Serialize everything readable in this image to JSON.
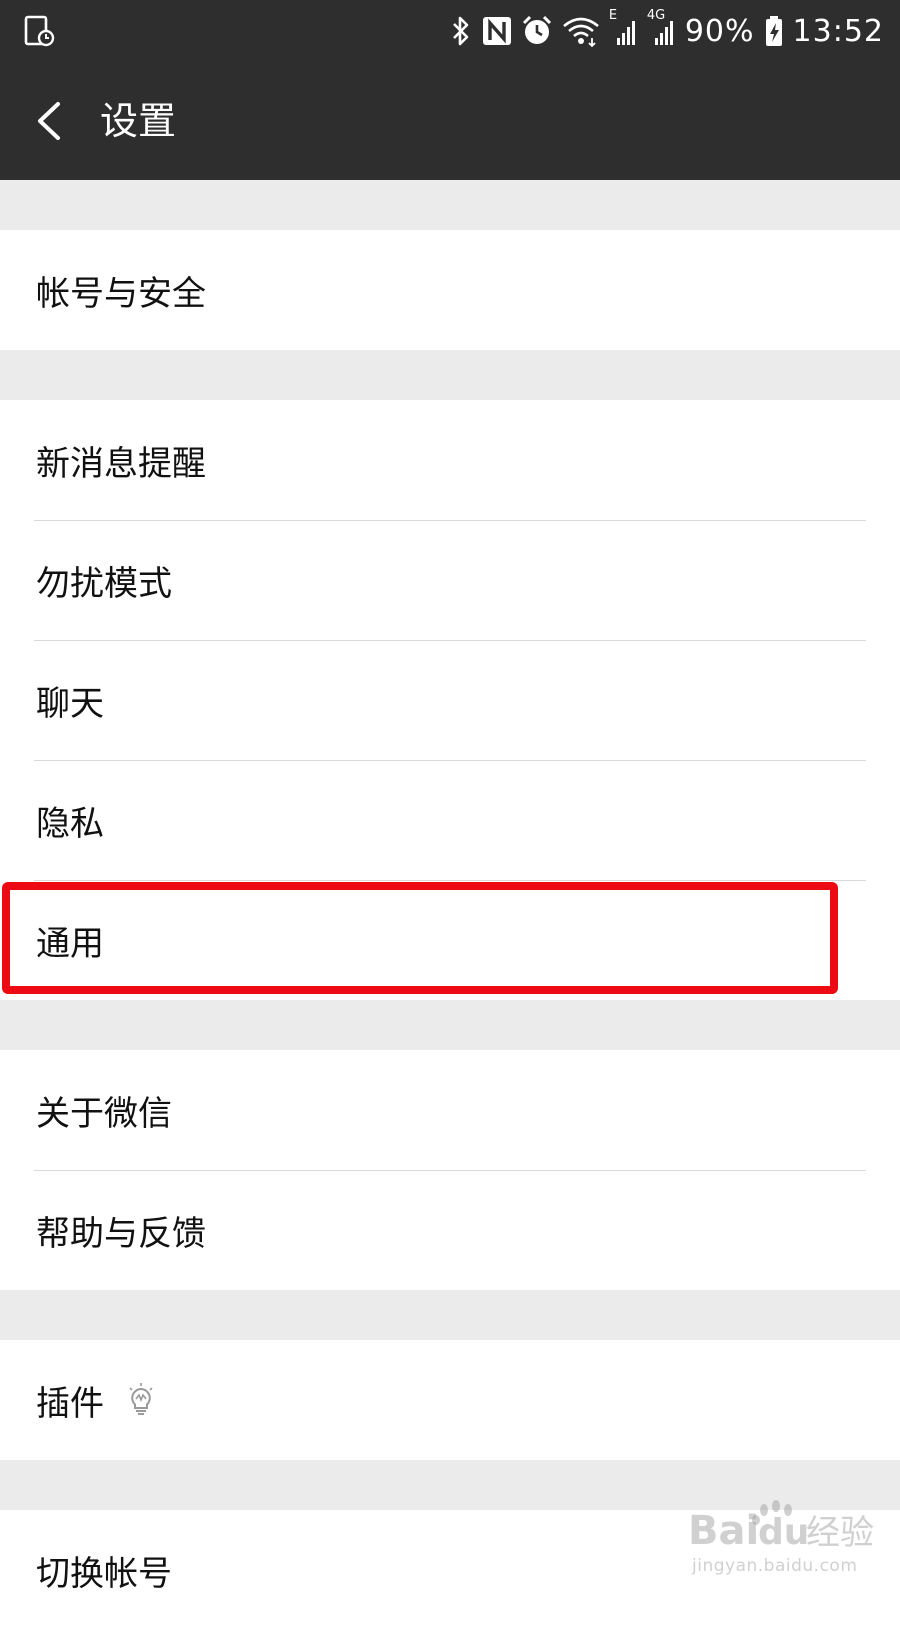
{
  "status_bar": {
    "battery": "90%",
    "time": "13:52",
    "icons": [
      "screenshot-icon",
      "bluetooth-icon",
      "nfc-icon",
      "alarm-icon",
      "wifi-icon",
      "signal-e-icon",
      "signal-4g-icon",
      "battery-charging-icon"
    ],
    "network_labels": [
      "E",
      "4G"
    ]
  },
  "header": {
    "title": "设置",
    "back_icon": "chevron-left-icon"
  },
  "groups": [
    {
      "items": [
        {
          "label": "帐号与安全"
        }
      ]
    },
    {
      "items": [
        {
          "label": "新消息提醒"
        },
        {
          "label": "勿扰模式"
        },
        {
          "label": "聊天"
        },
        {
          "label": "隐私"
        },
        {
          "label": "通用",
          "highlighted": true
        }
      ]
    },
    {
      "items": [
        {
          "label": "关于微信"
        },
        {
          "label": "帮助与反馈"
        }
      ]
    },
    {
      "items": [
        {
          "label": "插件",
          "icon": "lightbulb-icon"
        }
      ]
    },
    {
      "items": [
        {
          "label": "切换帐号"
        }
      ]
    }
  ],
  "watermark": {
    "logo": "Baidu经验",
    "subtext": "jingyan.baidu.com"
  },
  "colors": {
    "header_bg": "#2e2e2e",
    "page_bg": "#ebebeb",
    "cell_bg": "#ffffff",
    "highlight": "#ee0a12",
    "divider": "#d9d9d9"
  }
}
